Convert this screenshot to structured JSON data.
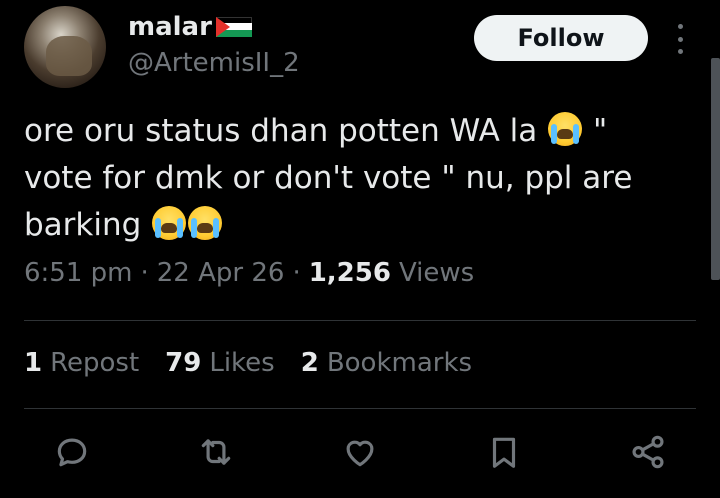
{
  "header": {
    "display_name": "malar",
    "flag_icon": "palestine-flag-icon",
    "handle": "@ArtemisII_2",
    "follow_label": "Follow"
  },
  "tweet": {
    "text_line_1": "ore oru status dhan potten WA la",
    "text_line_1_tail": " \"",
    "text_line_2": "vote for dmk or don't vote \" nu, ppl are",
    "text_line_3": "barking",
    "emoji": "loudly-crying-face-emoji"
  },
  "meta": {
    "time": "6:51 pm",
    "date": "22 Apr 26",
    "separator": "·",
    "views_count": "1,256",
    "views_label": "Views"
  },
  "stats": {
    "reposts_count": "1",
    "reposts_label": "Repost",
    "likes_count": "79",
    "likes_label": "Likes",
    "bookmarks_count": "2",
    "bookmarks_label": "Bookmarks"
  },
  "actions": [
    "reply-icon",
    "repost-icon",
    "like-icon",
    "bookmark-icon",
    "share-icon"
  ],
  "colors": {
    "background": "#000000",
    "primary_text": "#e7e9ea",
    "secondary_text": "#71767b",
    "follow_button_bg": "#eff3f4"
  }
}
